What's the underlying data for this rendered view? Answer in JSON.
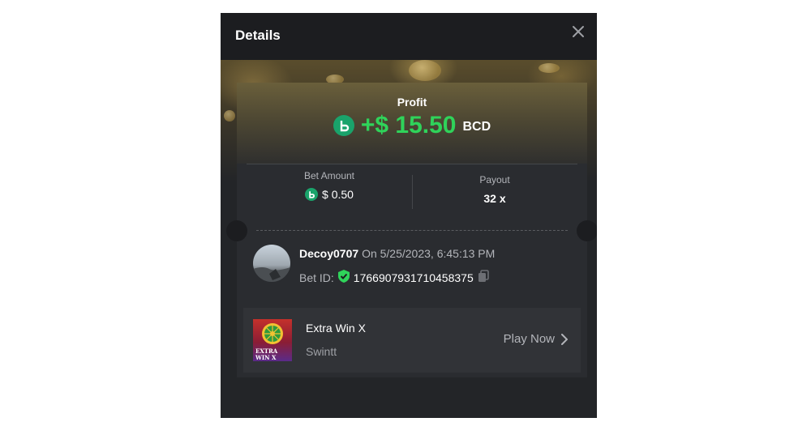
{
  "header": {
    "title": "Details"
  },
  "profit": {
    "label": "Profit",
    "value": "+$ 15.50",
    "currency": "BCD"
  },
  "bet": {
    "amount_label": "Bet Amount",
    "amount_value": "$ 0.50",
    "payout_label": "Payout",
    "payout_value": "32 x"
  },
  "user": {
    "name": "Decoy0707",
    "date": "On 5/25/2023, 6:45:13 PM",
    "bet_id_label": "Bet ID:",
    "bet_id": "1766907931710458375"
  },
  "game": {
    "name": "Extra Win X",
    "provider": "Swintt",
    "play_label": "Play Now",
    "thumb_text": "EXTRA WIN X"
  },
  "colors": {
    "profit_green": "#2fd35a",
    "coin_green": "#1aa36b",
    "modal_bg": "#232528"
  },
  "icons": {
    "close": "close-icon",
    "coin": "bcd-coin-icon",
    "verified": "shield-check-icon",
    "copy": "copy-icon",
    "chevron": "chevron-right-icon"
  }
}
